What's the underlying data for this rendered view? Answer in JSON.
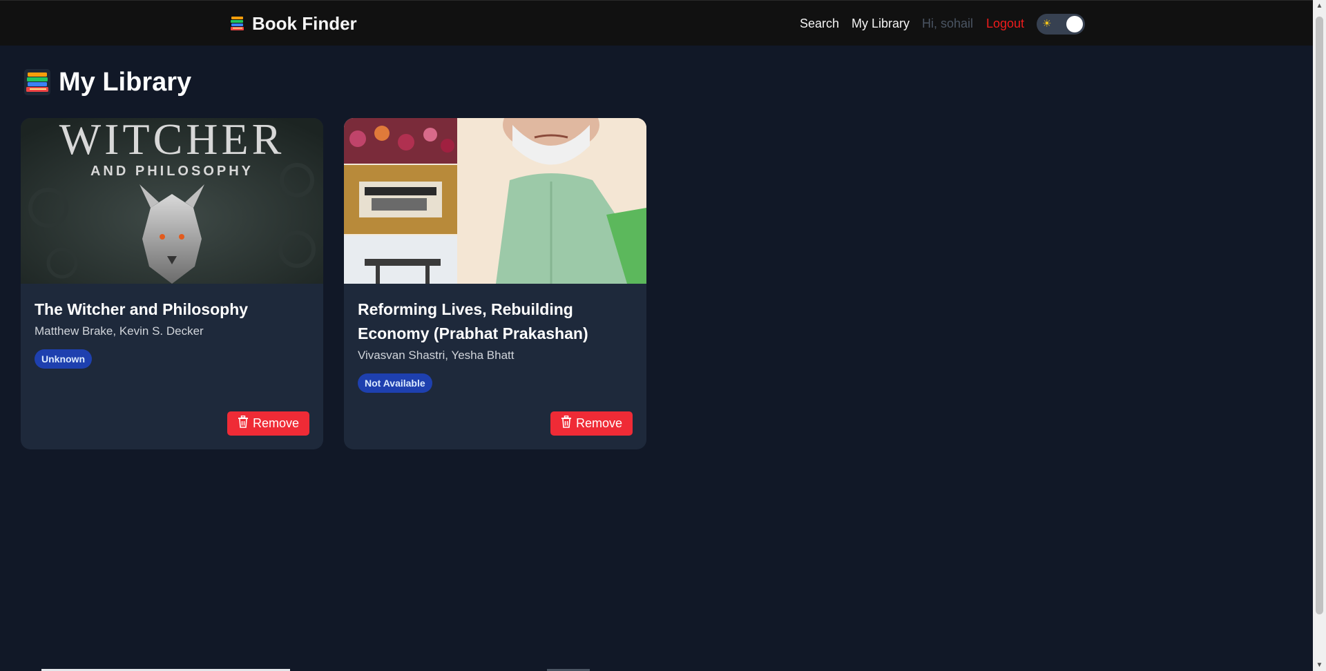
{
  "header": {
    "brand": "Book Finder",
    "brand_icon": "books-icon",
    "nav": {
      "search": "Search",
      "library": "My Library",
      "greeting": "Hi, sohail",
      "logout": "Logout"
    },
    "theme_toggle": {
      "icon": "sun-icon",
      "state": "dark"
    }
  },
  "page": {
    "title": "My Library",
    "title_icon": "books-icon"
  },
  "books": [
    {
      "title": "The Witcher and Philosophy",
      "authors": "Matthew Brake, Kevin S. Decker",
      "status": "Unknown",
      "cover_text_line1": "WITCHER",
      "cover_text_line2": "AND PHILOSOPHY",
      "remove_label": "Remove"
    },
    {
      "title": "Reforming Lives, Rebuilding Economy (Prabhat Prakashan)",
      "authors": "Vivasvan Shastri, Yesha Bhatt",
      "status": "Not Available",
      "remove_label": "Remove"
    }
  ],
  "colors": {
    "background": "#111827",
    "navbar": "#111111",
    "card": "#1e293b",
    "badge": "#1e40af",
    "remove": "#ef2b36",
    "logout": "#ef1c1c"
  }
}
